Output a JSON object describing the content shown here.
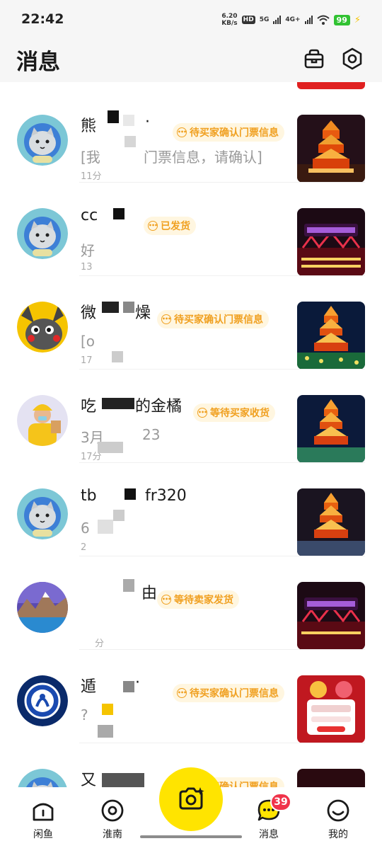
{
  "status_bar": {
    "time": "22:42",
    "net_speed_value": "6.20",
    "net_speed_unit": "KB/s",
    "hd_label": "HD",
    "sim1": "5G",
    "sim2": "4G+",
    "battery": "99"
  },
  "header": {
    "title": "消息",
    "icons": [
      "bag-icon",
      "settings-hexagon-icon"
    ]
  },
  "colors": {
    "accent": "#ffe400",
    "badge_text": "#f0a020",
    "badge_bg": "#fff6e0",
    "nav_badge": "#f0334a"
  },
  "conversations": [
    {
      "name": "熊",
      "name2": "·",
      "badge": "待买家确认门票信息",
      "message": "[我",
      "message2": "门票信息，请确认]",
      "time": "11分"
    },
    {
      "name": "cc",
      "name2": "",
      "badge": "已发货",
      "message": "好",
      "message2": "",
      "time": "13"
    },
    {
      "name": "微",
      "name2": "燥",
      "badge": "待买家确认门票信息",
      "message": "[o",
      "message2": "",
      "time": "17"
    },
    {
      "name": "吃",
      "name2": "的金橘",
      "badge": "等待买家收货",
      "message": "3月",
      "message2": "23",
      "time": "17分"
    },
    {
      "name": "tb",
      "name2": "fr320",
      "badge": "",
      "message": "6",
      "message2": "",
      "time": "2"
    },
    {
      "name": "",
      "name2": "由",
      "badge": "等待卖家发货",
      "message": "",
      "message2": "",
      "time": "分"
    },
    {
      "name": "遁",
      "name2": "·",
      "badge": "待买家确认门票信息",
      "message": "?",
      "message2": "",
      "time": ""
    },
    {
      "name": "又",
      "name2": "",
      "badge": "待买家确认门票信息",
      "message": "",
      "message2": "",
      "time": ""
    }
  ],
  "nav": {
    "items": [
      {
        "label": "闲鱼",
        "icon": "xianyu-home-icon"
      },
      {
        "label": "淮南",
        "icon": "location-pin-icon"
      },
      {
        "label": "消息",
        "icon": "chat-bubble-icon",
        "badge": "39"
      },
      {
        "label": "我的",
        "icon": "smiley-profile-icon"
      }
    ],
    "fab_icon": "camera-sparkle-icon"
  }
}
